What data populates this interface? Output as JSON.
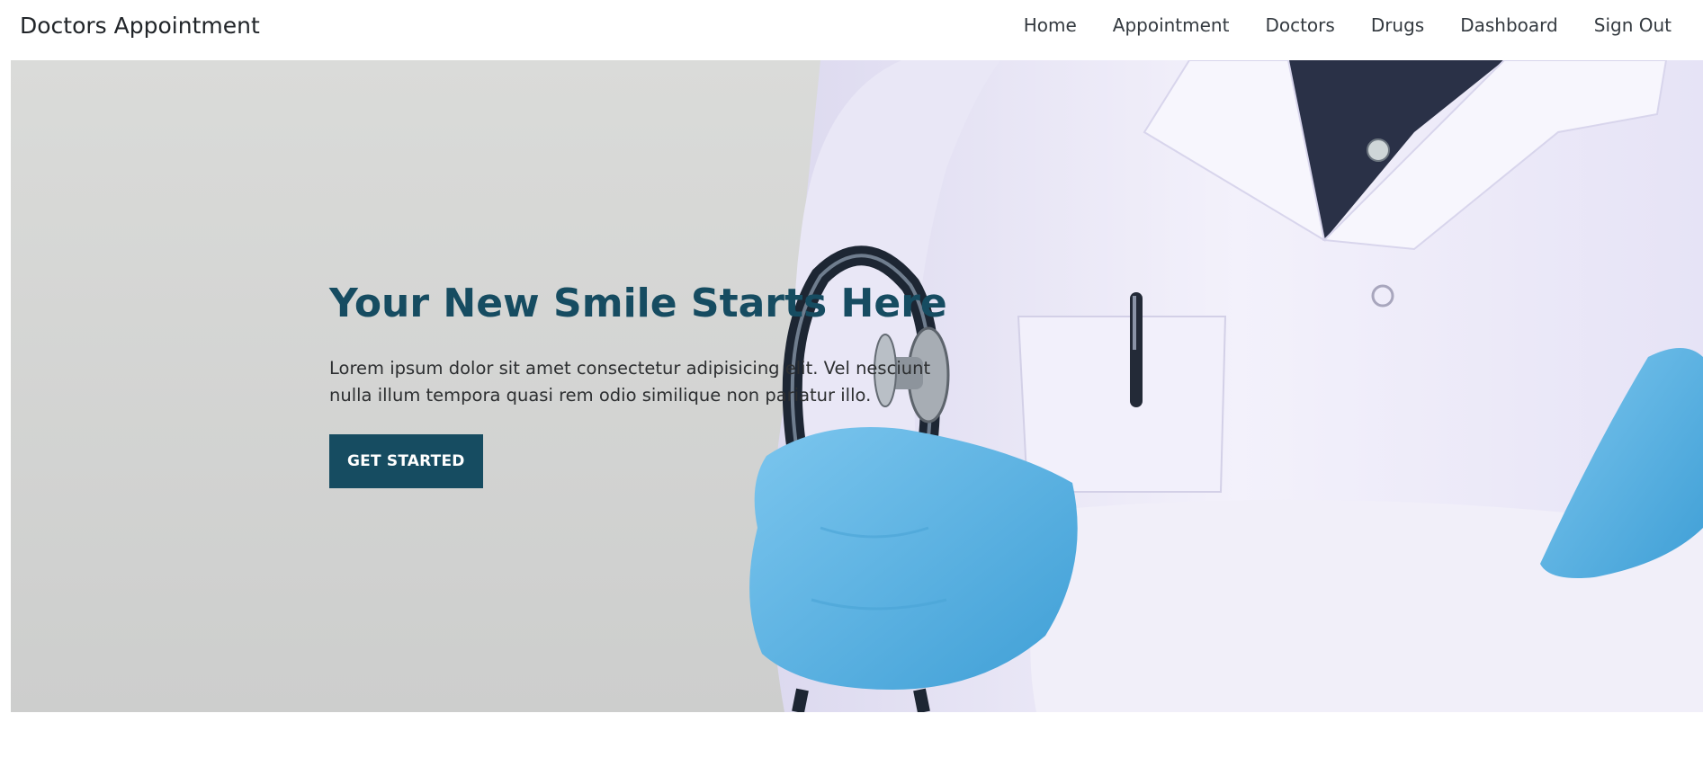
{
  "navbar": {
    "brand": "Doctors Appointment",
    "links": [
      {
        "label": "Home"
      },
      {
        "label": "Appointment"
      },
      {
        "label": "Doctors"
      },
      {
        "label": "Drugs"
      },
      {
        "label": "Dashboard"
      },
      {
        "label": "Sign Out"
      }
    ]
  },
  "hero": {
    "title": "Your New Smile Starts Here",
    "text": "Lorem ipsum dolor sit amet consectetur adipisicing elit. Vel nesciunt nulla illum tempora quasi rem odio similique non pariatur illo.",
    "cta_label": "GET STARTED",
    "image_alt": "doctor-with-stethoscope",
    "colors": {
      "primary": "#164c61",
      "glove": "#5ab4e6",
      "coat": "#eeecfa",
      "shirt": "#2a3147",
      "background": "#d6d7d5"
    }
  }
}
